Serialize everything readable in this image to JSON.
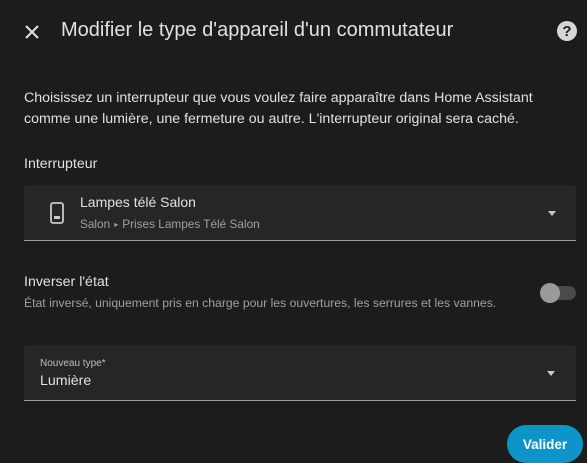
{
  "dialog": {
    "title": "Modifier le type d'appareil d'un commutateur",
    "close_icon": "close-icon",
    "help_icon": "help-circle-icon",
    "description": "Choisissez un interrupteur que vous voulez faire apparaître dans Home Assistant comme une lumière, une fermeture ou autre. L'interrupteur original sera caché."
  },
  "switch_picker": {
    "label": "Interrupteur",
    "icon": "power-socket-icon",
    "entity_name": "Lampes télé Salon",
    "area": "Salon",
    "separator": "▸",
    "device": "Prises Lampes Télé Salon"
  },
  "invert": {
    "title": "Inverser l'état",
    "description": "État inversé, uniquement pris en charge pour les ouvertures, les serrures et les vannes.",
    "enabled": false
  },
  "type_select": {
    "label": "Nouveau type*",
    "value": "Lumière"
  },
  "actions": {
    "submit_label": "Valider"
  },
  "colors": {
    "background": "#1c1c1c",
    "field_background": "#262626",
    "accent": "#0d95c9",
    "secondary_text": "#a0a0a0"
  }
}
